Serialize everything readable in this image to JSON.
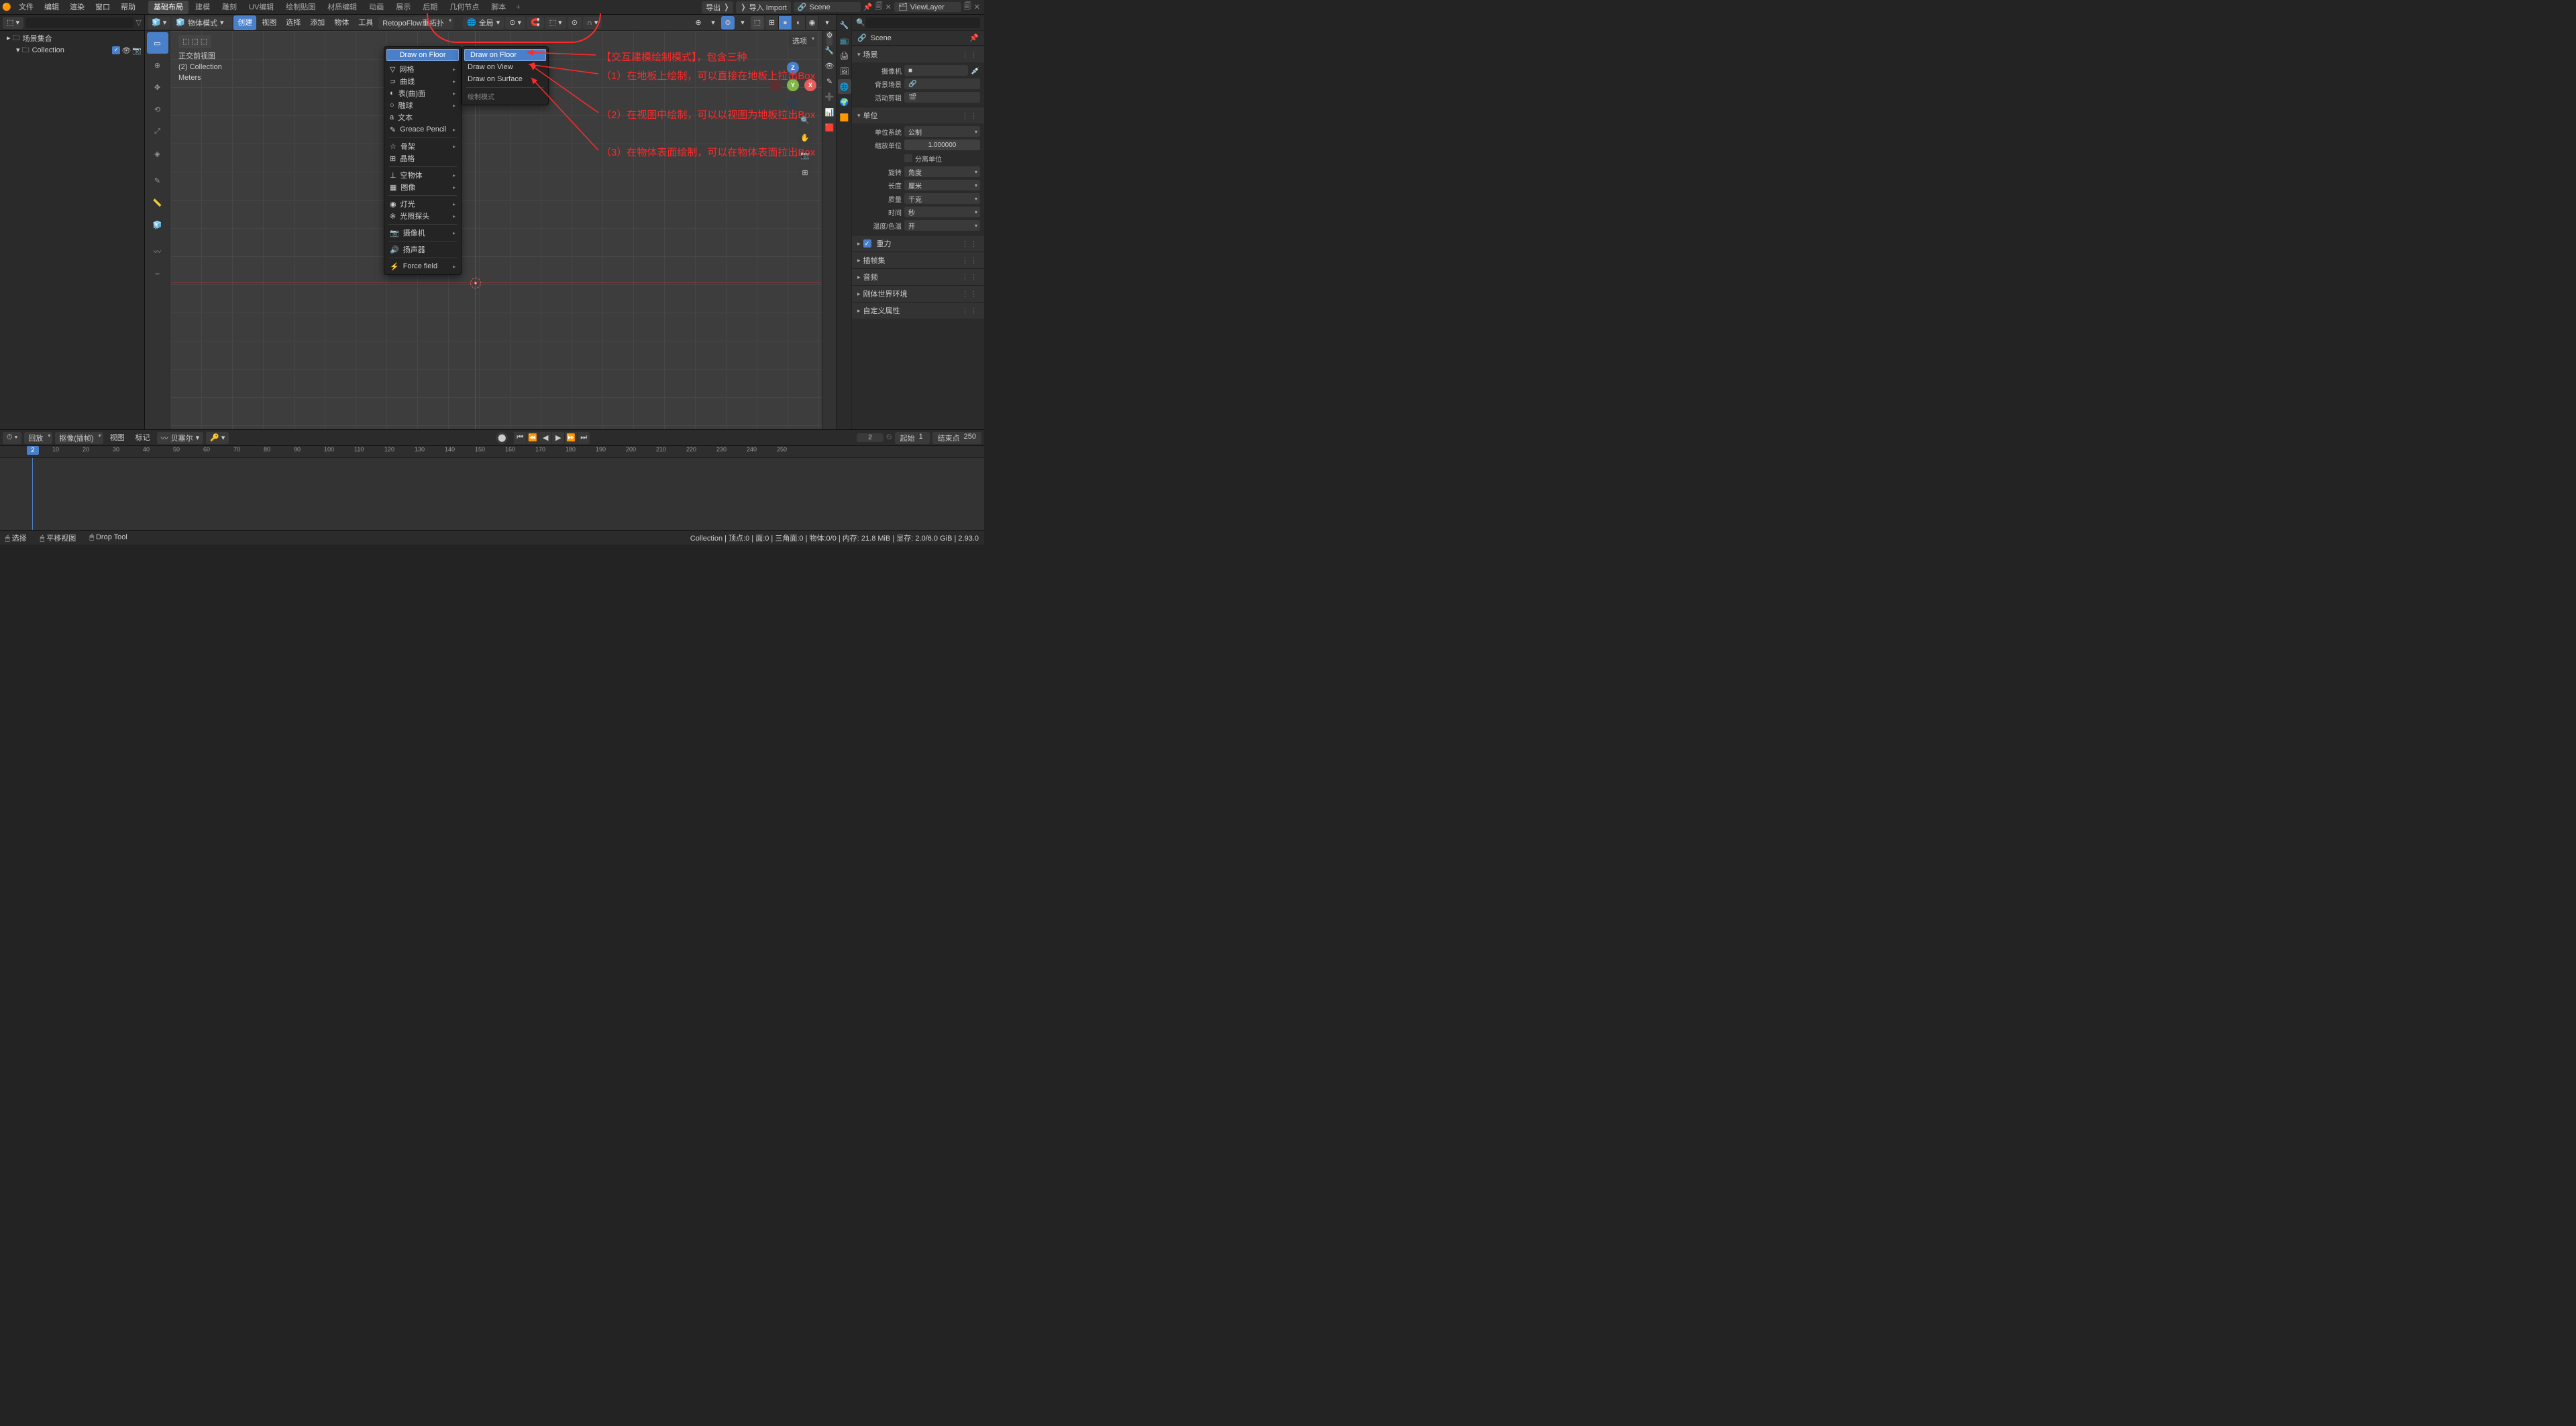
{
  "topmenu": [
    "文件",
    "编辑",
    "渲染",
    "窗口",
    "帮助"
  ],
  "workspaces": [
    "基础布局",
    "建模",
    "雕刻",
    "UV编辑",
    "绘制贴图",
    "材质编辑",
    "动画",
    "展示",
    "后期",
    "几何节点",
    "脚本"
  ],
  "workspace_active": 0,
  "top_right": {
    "export": "导出",
    "import": "导入 Import",
    "scene_label": "Scene",
    "vlayer_label": "ViewLayer"
  },
  "outliner": {
    "root": "场景集合",
    "coll": "Collection"
  },
  "viewport": {
    "mode": "物体模式",
    "menus": [
      "创建",
      "视图",
      "选择",
      "添加",
      "物体",
      "工具"
    ],
    "menu_active": 0,
    "retopo": "RetopoFlow重拓扑",
    "global": "全局",
    "options": "选项",
    "info": {
      "view": "正交前视图",
      "coll": "(2) Collection",
      "units": "Meters"
    }
  },
  "create_menu": {
    "selected": "Draw on Floor",
    "items": [
      {
        "icon": "▽",
        "label": "网格",
        "sub": true
      },
      {
        "icon": "⊃",
        "label": "曲线",
        "sub": true
      },
      {
        "icon": "◐",
        "label": "表(曲)面",
        "sub": true
      },
      {
        "icon": "○",
        "label": "融球",
        "sub": true
      },
      {
        "icon": "a",
        "label": "文本"
      },
      {
        "icon": "✎",
        "label": "Greace Pencil",
        "sub": true
      }
    ],
    "items2": [
      {
        "icon": "☆",
        "label": "骨架",
        "sub": true
      },
      {
        "icon": "⊞",
        "label": "晶格"
      }
    ],
    "items3": [
      {
        "icon": "⊥",
        "label": "空物体",
        "sub": true
      },
      {
        "icon": "▦",
        "label": "图像",
        "sub": true
      }
    ],
    "items4": [
      {
        "icon": "◉",
        "label": "灯光",
        "sub": true
      },
      {
        "icon": "※",
        "label": "光照探头",
        "sub": true
      }
    ],
    "items5": [
      {
        "icon": "📷",
        "label": "摄像机",
        "sub": true
      }
    ],
    "items6": [
      {
        "icon": "🔊",
        "label": "扬声器"
      }
    ],
    "items7": [
      {
        "icon": "⚡",
        "label": "Force field",
        "sub": true
      }
    ]
  },
  "submenu": {
    "items": [
      "Draw on Floor",
      "Draw on View",
      "Draw on Surface"
    ],
    "heading": "绘制模式"
  },
  "annotations": {
    "a0": "【交互建模绘制模式】，包含三种",
    "a1": "（1）在地板上绘制，可以直接在地板上拉出Box",
    "a2": "（2）在视图中绘制，可以以视图为地板拉出Box",
    "a3": "（3）在物体表面绘制，可以在物体表面拉出Box"
  },
  "props": {
    "scene": "Scene",
    "panel_scene": "场景",
    "camera": "摄像机",
    "bg_scene": "背景场景",
    "active_clip": "活动剪辑",
    "units": "单位",
    "unit_sys": "单位系统",
    "unit_sys_v": "公制",
    "unit_scale": "缩放单位",
    "unit_scale_v": "1.000000",
    "separate": "分离单位",
    "rotation": "旋转",
    "rotation_v": "角度",
    "length": "长度",
    "length_v": "厘米",
    "mass": "质量",
    "mass_v": "千克",
    "time": "时间",
    "time_v": "秒",
    "temp": "温度/色温",
    "temp_v": "开",
    "gravity": "重力",
    "keysets": "插帧集",
    "audio": "音频",
    "rigidbody": "刚体世界环境",
    "custom": "自定义属性"
  },
  "timeline": {
    "playback": "回放",
    "keying": "抠像(插帧)",
    "view": "视图",
    "marker": "标记",
    "bezier": "贝塞尔",
    "current": 2,
    "start_lbl": "起始",
    "start": 1,
    "end_lbl": "结束点",
    "end": 250,
    "ticks": [
      10,
      20,
      30,
      40,
      50,
      60,
      70,
      80,
      90,
      100,
      110,
      120,
      130,
      140,
      150,
      160,
      170,
      180,
      190,
      200,
      210,
      220,
      230,
      240,
      250
    ]
  },
  "status": {
    "select": "选择",
    "pan": "平移视图",
    "drop": "Drop Tool",
    "right": "Collection | 顶点:0 | 面:0 | 三角面:0 | 物体:0/0 | 内存: 21.8 MiB | 显存: 2.0/6.0 GiB | 2.93.0"
  }
}
